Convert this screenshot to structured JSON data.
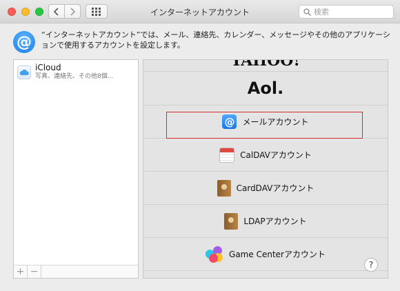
{
  "window": {
    "title": "インターネットアカウント",
    "search_placeholder": "検索",
    "colors": {
      "close": "#fc5f57",
      "minimize": "#fdbc2e",
      "zoom": "#28c940"
    }
  },
  "header": {
    "description": "“インターネットアカウント”では、メール、連絡先、カレンダー、メッセージやその他のアプリケーションで使用するアカウントを設定します。",
    "icon": "at-icon"
  },
  "accounts": [
    {
      "name": "iCloud",
      "subtitle": "写真、連絡先、その他8個...",
      "icon": "icloud-icon"
    }
  ],
  "account_controls": {
    "add": "+",
    "remove": "−"
  },
  "providers": {
    "yahoo": "YAHOO!",
    "aol": "Aol.",
    "mail": "メールアカウント",
    "caldav": "CalDAVアカウント",
    "carddav": "CardDAVアカウント",
    "ldap": "LDAPアカウント",
    "game_center": "Game Centerアカウント",
    "selected": "mail",
    "selection_color": "#d12a2a"
  },
  "help_label": "?"
}
